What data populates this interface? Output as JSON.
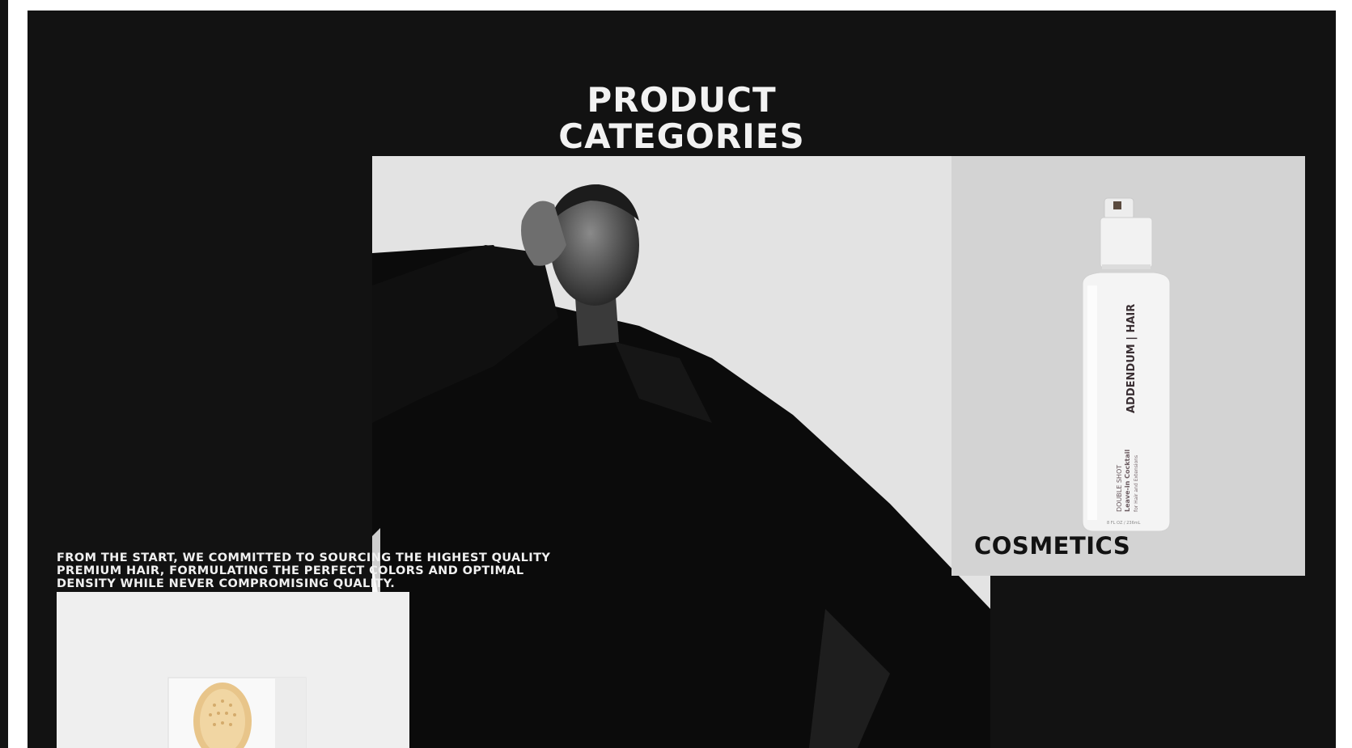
{
  "section": {
    "title_line1": "PRODUCT",
    "title_line2": "CATEGORIES",
    "tagline": "FROM THE START, WE COMMITTED TO SOURCING THE HIGHEST QUALITY PREMIUM HAIR, FORMULATING THE PERFECT COLORS AND OPTIMAL DENSITY WHILE NEVER COMPROMISING QUALITY."
  },
  "categories": [
    {
      "label": "COSMETICS",
      "product": {
        "brand": "ADDENDUM | HAIR",
        "line1": "DOUBLE SHOT",
        "line2": "Leave-in Cocktail",
        "line3": "for Hair and Extensions",
        "size": "8 FL OZ / 236mL"
      }
    }
  ],
  "colors": {
    "panel_bg": "#121212",
    "text_light": "#f2f2f2",
    "card_bg": "#d3d3d3"
  }
}
